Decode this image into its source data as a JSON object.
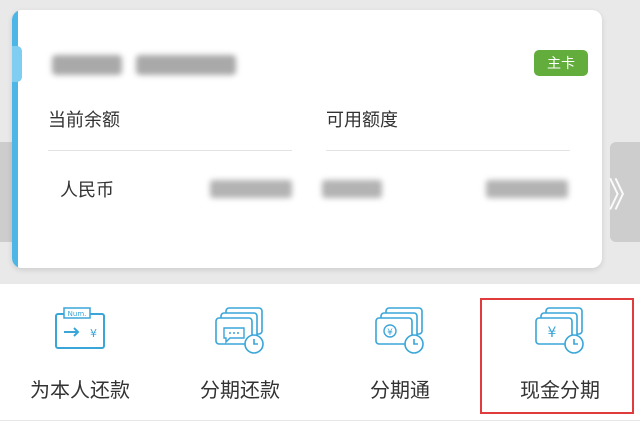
{
  "card": {
    "badge": "主卡",
    "balance_label": "当前余额",
    "available_label": "可用额度",
    "currency": "人民币"
  },
  "nav": {
    "prev_glyph": "《",
    "next_glyph": "》"
  },
  "menu": {
    "items": [
      {
        "label": "为本人还款",
        "icon": "num-transfer-yuan-icon"
      },
      {
        "label": "分期还款",
        "icon": "installment-repay-icon"
      },
      {
        "label": "分期通",
        "icon": "installment-pass-icon"
      },
      {
        "label": "现金分期",
        "icon": "cash-installment-icon"
      }
    ]
  },
  "colors": {
    "accent": "#4db6e6",
    "badge_green": "#62ad3b",
    "highlight_red": "#e03c3c"
  }
}
